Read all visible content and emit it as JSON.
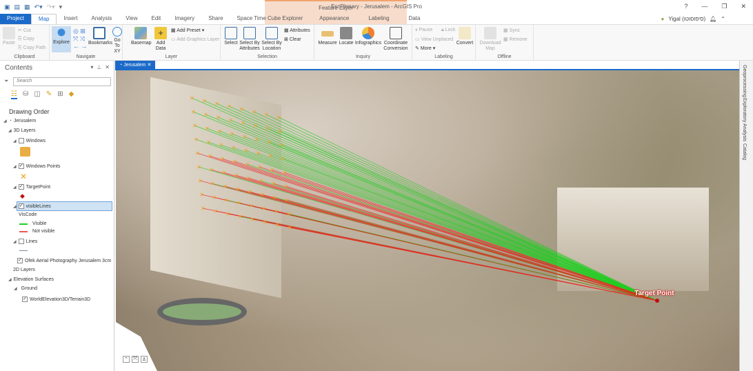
{
  "window": {
    "title": "EsriPlenary - Jerusalem - ArcGIS Pro",
    "help": "?",
    "minimize": "—",
    "restore": "❐",
    "close": "✕",
    "user": "Yigal (סיפוסוטו)"
  },
  "contextual": {
    "label": "Feature Layer"
  },
  "tabs": [
    "Project",
    "Map",
    "Insert",
    "Analysis",
    "View",
    "Edit",
    "Imagery",
    "Share",
    "Space Time Cube Explorer",
    "Appearance",
    "Labeling",
    "Data"
  ],
  "ribbon": {
    "clipboard": {
      "label": "Clipboard",
      "paste": "Paste",
      "cut": "Cut",
      "copy": "Copy",
      "copy_path": "Copy Path"
    },
    "navigate": {
      "label": "Navigate",
      "explore": "Explore",
      "bookmarks": "Bookmarks",
      "go_to_xy": "Go To XY"
    },
    "layer": {
      "label": "Layer",
      "basemap": "Basemap",
      "add_data": "Add Data",
      "add_preset": "Add Preset",
      "add_graphics_layer": "Add Graphics Layer"
    },
    "selection": {
      "label": "Selection",
      "select": "Select",
      "select_by_attributes": "Select By Attributes",
      "select_by_location": "Select By Location",
      "attributes": "Attributes",
      "clear": "Clear"
    },
    "inquiry": {
      "label": "Inquiry",
      "measure": "Measure",
      "locate": "Locate",
      "infographics": "Infographics",
      "coordinate_conversion": "Coordinate Conversion"
    },
    "labeling": {
      "label": "Labeling",
      "pause": "Pause",
      "lock": "Lock",
      "view_unplaced": "View Unplaced",
      "more": "More",
      "convert": "Convert"
    },
    "offline": {
      "label": "Offline",
      "download_map": "Download Map",
      "sync": "Sync",
      "remove": "Remove"
    }
  },
  "contents": {
    "title": "Contents",
    "search_placeholder": "Search",
    "drawing_order": "Drawing Order",
    "map": "Jerusalem",
    "layers_3d": "3D Layers",
    "windows": "Windows",
    "windows_points": "Windows Points",
    "target_point": "TargetPoint",
    "visible_lines": "visibleLines",
    "viscode": "VisCode",
    "visible": "Visible",
    "not_visible": "Not visible",
    "lines": "Lines",
    "ofek": "Ofek Aerial Photography Jerusalem 3cm",
    "layers_2d": "2D Layers",
    "elevation_surfaces": "Elevation Surfaces",
    "ground": "Ground",
    "terrain": "WorldElevation3D/Terrain3D"
  },
  "map": {
    "tab": "Jerusalem",
    "target_label": "Target Point"
  },
  "dock": [
    "Geoprocessing",
    "Exploratory Analysis",
    "Catalog"
  ],
  "colors": {
    "visible": "#22cc22",
    "not_visible": "#ee2222",
    "accent": "#1b6ac9"
  }
}
